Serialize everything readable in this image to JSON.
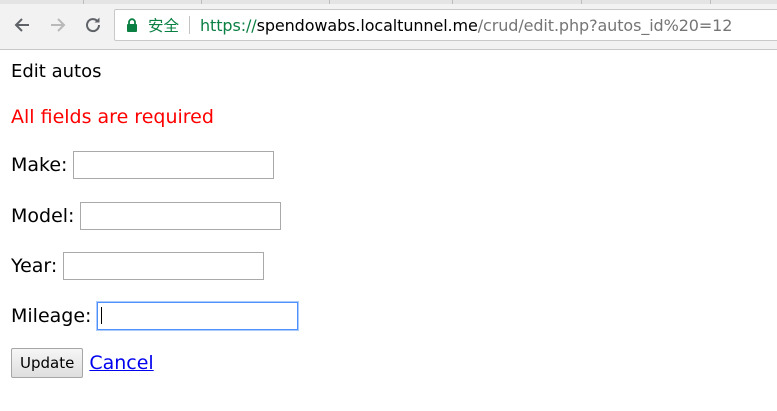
{
  "browser": {
    "secure_label": "安全",
    "url": {
      "scheme": "https://",
      "host": "spendowabs.localtunnel.me",
      "path": "/crud/edit.php?autos_id%20=12"
    },
    "icons": {
      "back": "back-arrow-icon",
      "forward": "forward-arrow-icon",
      "reload": "reload-icon",
      "lock": "lock-icon"
    },
    "colors": {
      "secure": "#0b8043"
    }
  },
  "page": {
    "title": "Edit autos",
    "error": "All fields are required",
    "error_color": "#ff0000",
    "fields": {
      "make": {
        "label": "Make:",
        "value": ""
      },
      "model": {
        "label": "Model:",
        "value": ""
      },
      "year": {
        "label": "Year:",
        "value": ""
      },
      "mileage": {
        "label": "Mileage:",
        "value": ""
      }
    },
    "update_label": "Update",
    "cancel_label": "Cancel"
  }
}
